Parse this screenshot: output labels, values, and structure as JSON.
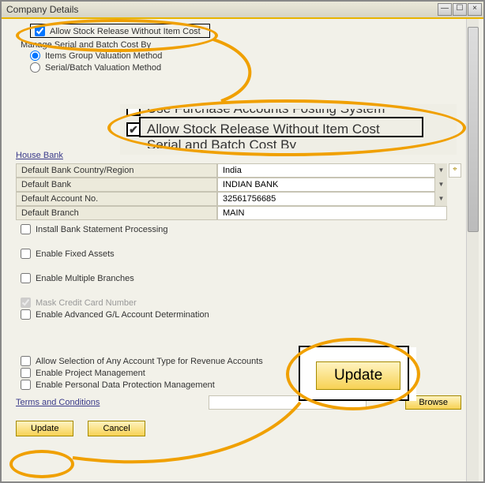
{
  "window": {
    "title": "Company Details"
  },
  "top_checks": {
    "allow_stock_release": "Allow Stock Release Without Item Cost",
    "manage_serial_batch": "Manage Serial and Batch Cost By",
    "items_group_method": "Items Group Valuation Method",
    "serial_batch_method": "Serial/Batch Valuation Method"
  },
  "house_bank": {
    "section": "House Bank",
    "default_bank_country_label": "Default Bank Country/Region",
    "default_bank_country_value": "India",
    "default_bank_label": "Default Bank",
    "default_bank_value": "INDIAN BANK",
    "default_account_label": "Default Account No.",
    "default_account_value": "32561756685",
    "default_branch_label": "Default Branch",
    "default_branch_value": "MAIN"
  },
  "lower_checks": {
    "install_bank": "Install Bank Statement Processing",
    "enable_fixed_assets": "Enable Fixed Assets",
    "enable_multiple_branches": "Enable Multiple Branches",
    "mask_cc": "Mask Credit Card Number",
    "enable_adv_gl": "Enable Advanced G/L Account Determination",
    "allow_selection_revenue": "Allow Selection of Any Account Type for Revenue Accounts",
    "enable_project_mgmt": "Enable Project Management",
    "enable_pdp_mgmt": "Enable Personal Data Protection Management"
  },
  "terms": {
    "label": "Terms and Conditions",
    "browse": "Browse"
  },
  "footer": {
    "update": "Update",
    "cancel": "Cancel"
  },
  "magnify1": {
    "line1_partial": "Use Furchase Accounts Fosting System",
    "line2": "Allow Stock Release Without Item Cost",
    "line3_partial": "Serial and Batch Cost By"
  },
  "magnify2": {
    "update": "Update"
  }
}
